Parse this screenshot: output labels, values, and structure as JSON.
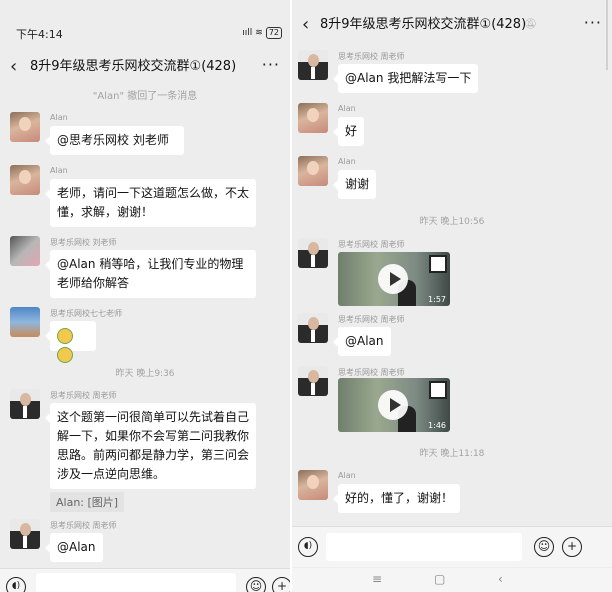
{
  "left": {
    "status": {
      "time": "下午4:14",
      "signal": "ııll",
      "battery": "72"
    },
    "title": "8升9年级思考乐网校交流群①(428)",
    "recall_notice": "\"Alan\" 撤回了一条消息",
    "messages": [
      {
        "sender": "Alan",
        "text": "@思考乐网校  刘老师"
      },
      {
        "sender": "Alan",
        "text": "老师，请问一下这道题怎么做，不太懂，求解，谢谢！"
      },
      {
        "sender": "思考乐网校 刘老师",
        "text": "@Alan 稍等哈，让我们专业的物理老师给你解答"
      },
      {
        "sender": "思考乐网校七七老师",
        "text": ""
      },
      {
        "timestamp": "昨天 晚上9:36"
      },
      {
        "sender": "思考乐网校 周老师",
        "text": "这个题第一问很简单可以先试着自己解一下，如果你不会写第二问我教你思路。前两问都是静力学，第三问会涉及一点逆向思维。",
        "quote": "Alan: [图片]"
      },
      {
        "sender": "思考乐网校 周老师",
        "text": "@Alan"
      }
    ]
  },
  "right": {
    "title": "8升9年级思考乐网校交流群①(428)",
    "messages": [
      {
        "sender": "思考乐网校 周老师",
        "text": "@Alan 我把解法写一下"
      },
      {
        "sender": "Alan",
        "text": "好"
      },
      {
        "sender": "Alan",
        "text": "谢谢"
      },
      {
        "timestamp": "昨天 晚上10:56"
      },
      {
        "sender": "思考乐网校 周老师",
        "video_duration": "1:57"
      },
      {
        "sender": "思考乐网校 周老师",
        "text": "@Alan"
      },
      {
        "sender": "思考乐网校 周老师",
        "video_duration": "1:46"
      },
      {
        "timestamp": "昨天 晚上11:18"
      },
      {
        "sender": "Alan",
        "text": "好的，懂了，谢谢！"
      }
    ]
  },
  "icons": {
    "back": "back-icon",
    "more": "more-icon",
    "mute": "mute-icon",
    "voice": "voice-icon",
    "emoji": "emoji-icon",
    "plus": "plus-icon",
    "play": "play-icon"
  },
  "colors": {
    "chat_bg": "#ededed",
    "bubble": "#ffffff",
    "meta_text": "#a3a3a3"
  }
}
